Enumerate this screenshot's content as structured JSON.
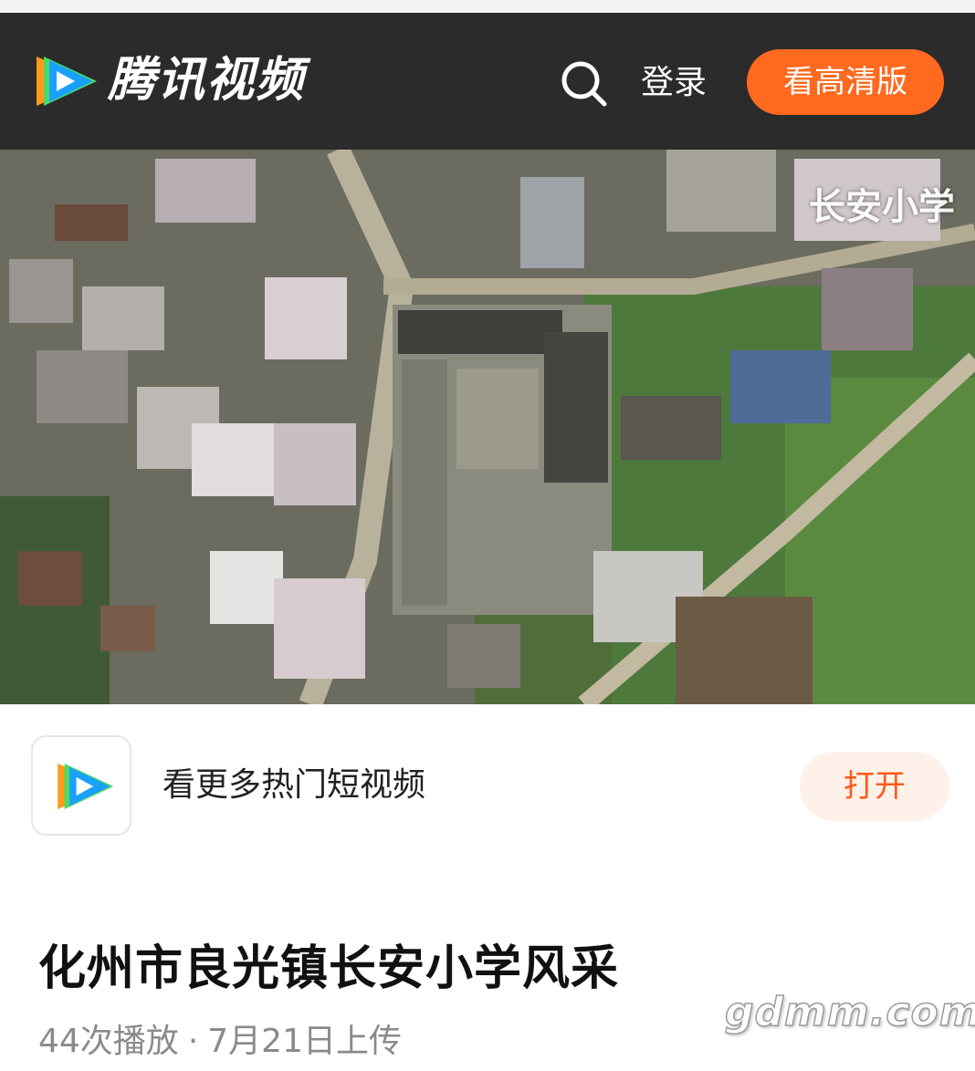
{
  "header": {
    "logo_text": "腾讯视频",
    "login_label": "登录",
    "hd_button_label": "看高清版"
  },
  "video": {
    "overlay_caption": "长安小学"
  },
  "promo": {
    "text": "看更多热门短视频",
    "open_label": "打开"
  },
  "title": "化州市良光镇长安小学风采",
  "meta": {
    "plays": "44次播放",
    "separator": "·",
    "upload": "7月21日上传"
  },
  "watermark": "gdmm.com",
  "colors": {
    "header_bg": "#2b2b2b",
    "accent_orange": "#ff6a1f",
    "open_btn_bg": "#fdf1ea",
    "open_btn_text": "#ff5a17",
    "logo_blue": "#1aa1ff",
    "logo_green": "#4cd964",
    "logo_orange": "#ff9a1a"
  },
  "icons": {
    "logo": "tencent-video-logo-icon",
    "search": "search-icon",
    "app": "tencent-video-app-icon"
  }
}
